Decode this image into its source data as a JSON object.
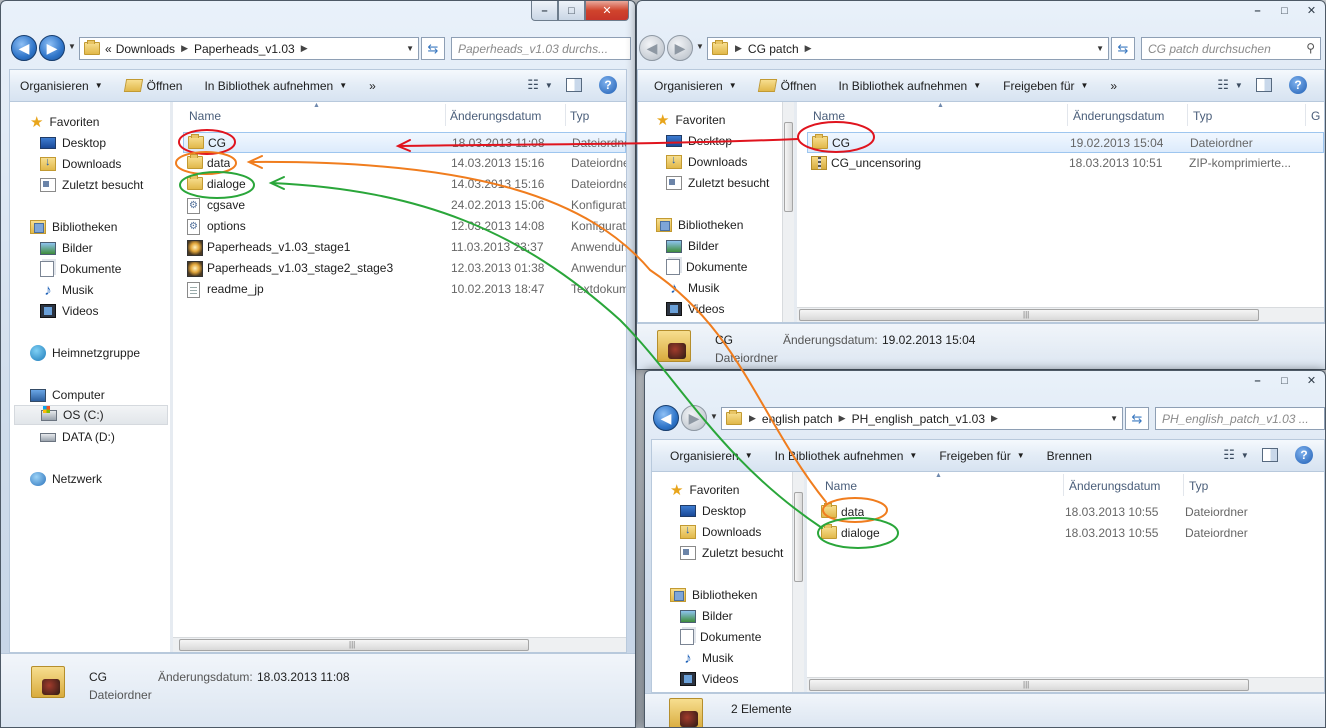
{
  "caption_buttons": {
    "minimize": "–",
    "maximize": "□",
    "close": "✕"
  },
  "win1": {
    "address": {
      "overflow": "«",
      "crumbs": [
        "Downloads",
        "Paperheads_v1.03"
      ]
    },
    "search_placeholder": "Paperheads_v1.03 durchs...",
    "toolbar": {
      "organize": "Organisieren",
      "open": "Öffnen",
      "library": "In Bibliothek aufnehmen",
      "more": "»"
    },
    "nav": {
      "favorites": "Favoriten",
      "desktop": "Desktop",
      "downloads": "Downloads",
      "recent": "Zuletzt besucht",
      "libraries": "Bibliotheken",
      "pictures": "Bilder",
      "documents": "Dokumente",
      "music": "Musik",
      "videos": "Videos",
      "homegroup": "Heimnetzgruppe",
      "computer": "Computer",
      "drive_c": "OS (C:)",
      "drive_d": "DATA (D:)",
      "network": "Netzwerk"
    },
    "columns": {
      "name": "Name",
      "date": "Änderungsdatum",
      "type": "Typ"
    },
    "files": [
      {
        "name": "CG",
        "date": "18.03.2013 11:08",
        "type": "Dateiordner",
        "icon": "folder-icon"
      },
      {
        "name": "data",
        "date": "14.03.2013 15:16",
        "type": "Dateiordner",
        "icon": "folder-icon"
      },
      {
        "name": "dialoge",
        "date": "14.03.2013 15:16",
        "type": "Dateiordner",
        "icon": "folder-icon"
      },
      {
        "name": "cgsave",
        "date": "24.02.2013 15:06",
        "type": "Konfiguratio",
        "icon": "config-file-icon"
      },
      {
        "name": "options",
        "date": "12.03.2013 14:08",
        "type": "Konfiguratio",
        "icon": "config-file-icon"
      },
      {
        "name": "Paperheads_v1.03_stage1",
        "date": "11.03.2013 23:37",
        "type": "Anwendung",
        "icon": "application-icon"
      },
      {
        "name": "Paperheads_v1.03_stage2_stage3",
        "date": "12.03.2013 01:38",
        "type": "Anwendung",
        "icon": "application-icon"
      },
      {
        "name": "readme_jp",
        "date": "10.02.2013 18:47",
        "type": "Textdokum",
        "icon": "text-file-icon"
      }
    ],
    "details": {
      "name": "CG",
      "date_label": "Änderungsdatum:",
      "date": "18.03.2013 11:08",
      "type": "Dateiordner"
    }
  },
  "win2": {
    "address": {
      "crumbs": [
        "CG patch"
      ]
    },
    "search_placeholder": "CG patch durchsuchen",
    "toolbar": {
      "organize": "Organisieren",
      "open": "Öffnen",
      "library": "In Bibliothek aufnehmen",
      "share": "Freigeben für",
      "more": "»"
    },
    "nav": {
      "favorites": "Favoriten",
      "desktop": "Desktop",
      "downloads": "Downloads",
      "recent": "Zuletzt besucht",
      "libraries": "Bibliotheken",
      "pictures": "Bilder",
      "documents": "Dokumente",
      "music": "Musik",
      "videos": "Videos"
    },
    "columns": {
      "name": "Name",
      "date": "Änderungsdatum",
      "type": "Typ",
      "extra": "G"
    },
    "files": [
      {
        "name": "CG",
        "date": "19.02.2013 15:04",
        "type": "Dateiordner",
        "icon": "folder-icon"
      },
      {
        "name": "CG_uncensoring",
        "date": "18.03.2013 10:51",
        "type": "ZIP-komprimierte...",
        "icon": "zip-folder-icon"
      }
    ],
    "details": {
      "name": "CG",
      "date_label": "Änderungsdatum:",
      "date": "19.02.2013 15:04",
      "type": "Dateiordner"
    }
  },
  "win3": {
    "address": {
      "crumbs": [
        "english patch",
        "PH_english_patch_v1.03"
      ]
    },
    "search_placeholder": "PH_english_patch_v1.03 ...",
    "toolbar": {
      "organize": "Organisieren",
      "library": "In Bibliothek aufnehmen",
      "share": "Freigeben für",
      "burn": "Brennen"
    },
    "nav": {
      "favorites": "Favoriten",
      "desktop": "Desktop",
      "downloads": "Downloads",
      "recent": "Zuletzt besucht",
      "libraries": "Bibliotheken",
      "pictures": "Bilder",
      "documents": "Dokumente",
      "music": "Musik",
      "videos": "Videos"
    },
    "columns": {
      "name": "Name",
      "date": "Änderungsdatum",
      "type": "Typ"
    },
    "files": [
      {
        "name": "data",
        "date": "18.03.2013 10:55",
        "type": "Dateiordner",
        "icon": "folder-icon"
      },
      {
        "name": "dialoge",
        "date": "18.03.2013 10:55",
        "type": "Dateiordner",
        "icon": "folder-icon"
      }
    ],
    "status": "2 Elemente"
  },
  "annotation_colors": {
    "red": "#e0141e",
    "orange": "#f07d1e",
    "green": "#2aa63a"
  }
}
